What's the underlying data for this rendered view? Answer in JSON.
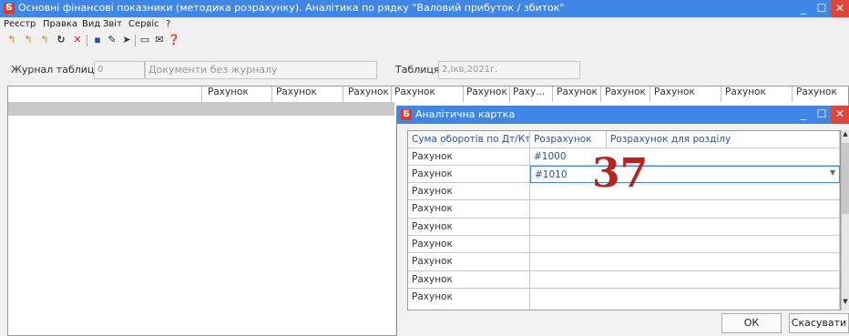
{
  "window": {
    "title": "Основні фінансові показники (методика розрахунку). Аналітика по рядку \"Валовий прибуток / збиток\"",
    "logo": "Б"
  },
  "menu": [
    "Реєстр",
    "Правка",
    "Вид",
    "Звіт",
    "Сервіс",
    "?"
  ],
  "toolbar_icons": [
    "new-doc-icon",
    "new-doc-2-icon",
    "new-doc-3-icon",
    "refresh-icon",
    "delete-icon",
    "save-icon",
    "pin-icon",
    "send-icon",
    "doc-icon",
    "mail-icon",
    "help-icon"
  ],
  "journal": {
    "label": "Журнал таблиць",
    "number": "0",
    "name": "Документи без журналу",
    "table_label": "Таблиця:",
    "table_value": "2,Iкв,2021г."
  },
  "main_table": {
    "headers": [
      "Рахунок",
      "Рахунок",
      "Рахунок",
      "Рахунок",
      "Рахунок",
      "Раху...",
      "Рахунок",
      "Рахунок",
      "Рахунок",
      "Рахунок",
      "Рахунок"
    ]
  },
  "dialog": {
    "title": "Аналітична картка",
    "logo": "Б",
    "headers": [
      "Сума оборотів по Дт/Кт",
      "Розрахунок",
      "Розрахунок для розділу"
    ],
    "rows": [
      {
        "label": "Рахунок",
        "value": "#1000"
      },
      {
        "label": "Рахунок",
        "value": "#1010"
      },
      {
        "label": "Рахунок",
        "value": ""
      },
      {
        "label": "Рахунок",
        "value": ""
      },
      {
        "label": "Рахунок",
        "value": ""
      },
      {
        "label": "Рахунок",
        "value": ""
      },
      {
        "label": "Рахунок",
        "value": ""
      },
      {
        "label": "Рахунок",
        "value": ""
      },
      {
        "label": "Рахунок",
        "value": ""
      }
    ],
    "ok_label": "ОК",
    "cancel_label": "Скасувати"
  },
  "badge": "37",
  "colors": {
    "titlebar": "#3f86e6",
    "close": "#e0453b",
    "logo": "#e03a24",
    "badge": "#b6241c",
    "link": "#2a4fae"
  }
}
